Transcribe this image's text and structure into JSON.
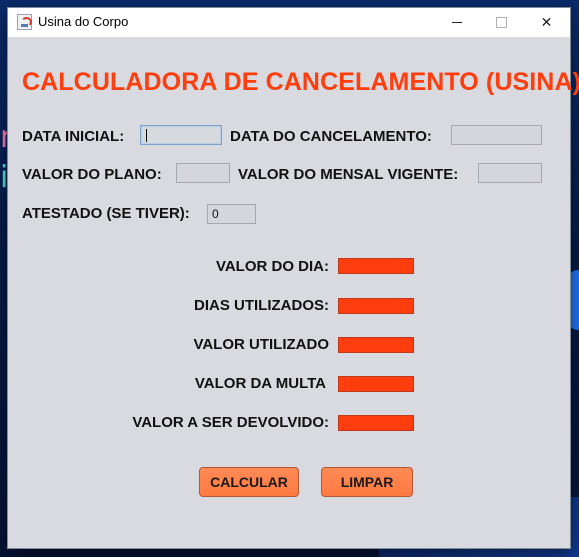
{
  "window": {
    "title": "Usina do Corpo",
    "controls": {
      "minimize": "minimize",
      "maximize": "maximize",
      "close": "✕"
    }
  },
  "heading": "CALCULADORA DE CANCELAMENTO (USINA)",
  "inputs": {
    "data_inicial": {
      "label": "DATA INICIAL:",
      "value": ""
    },
    "data_cancelamento": {
      "label": "DATA DO CANCELAMENTO:",
      "value": ""
    },
    "valor_plano": {
      "label": "VALOR DO PLANO:",
      "value": ""
    },
    "valor_mensal": {
      "label": "VALOR DO MENSAL VIGENTE:",
      "value": ""
    },
    "atestado": {
      "label": "ATESTADO (SE TIVER):",
      "value": "0"
    }
  },
  "results": [
    {
      "label": "VALOR DO DIA:"
    },
    {
      "label": "DIAS UTILIZADOS:"
    },
    {
      "label": "VALOR UTILIZADO"
    },
    {
      "label": "VALOR DA MULTA"
    },
    {
      "label": "VALOR A SER DEVOLVIDO:"
    }
  ],
  "buttons": {
    "calcular": "CALCULAR",
    "limpar": "LIMPAR"
  },
  "colors": {
    "accent": "#ff3d0d",
    "button": "#ff7a42",
    "panel": "#d8dae0"
  }
}
